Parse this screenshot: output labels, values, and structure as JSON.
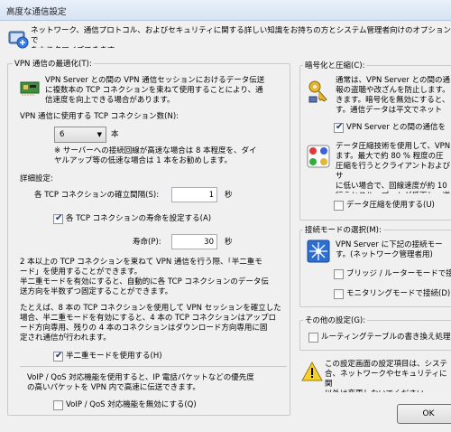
{
  "window": {
    "title": "高度な通信設定"
  },
  "header": {
    "description": "ネットワーク、通信プロトコル、およびセキュリティに関する詳しい知識をお持ちの方とシステム管理者向けのオプションで\nをカスタマイズできます。"
  },
  "vpn": {
    "group_title": "VPN 通信の最適化(T):",
    "intro": "VPN Server との間の VPN 通信セッションにおけるデータ伝送\nに複数本の TCP コネクションを束ねて使用することにより、通\n信速度を向上できる場合があります。",
    "count_label": "VPN 通信に使用する TCP コネクション数(N):",
    "count_value": "6",
    "count_unit": "本",
    "count_note": "※ サーバーへの接続回線が高速な場合は 8 本程度を、ダイ\nヤルアップ等の低速な場合は 1 本をお勧めします。",
    "detail_label": "詳細設定:",
    "interval_label": "各 TCP コネクションの確立間隔(S):",
    "interval_value": "1",
    "interval_unit": "秒",
    "lifetime_check_label": "各 TCP コネクションの寿命を設定する(A)",
    "lifetime_check_checked": true,
    "lifetime_label": "寿命(P):",
    "lifetime_value": "30",
    "lifetime_unit": "秒",
    "half_duplex_text1": "2 本以上の TCP コネクションを束ねて VPN 通信を行う際、「半二重モ\nード」を使用することができます。\n半二重モードを有効にすると、自動的に各 TCP コネクションのデータ伝\n送方向を半数ずつ固定することができます。",
    "half_duplex_text2": "たとえば、8 本の TCP コネクションを使用して VPN セッションを確立した\n場合、半二重モードを有効にすると、4 本の TCP コネクションはアップロ\nード方向専用、残りの 4 本のコネクションはダウンロード方向専用に固\n定され通信が行われます。",
    "half_duplex_check_label": "半二重モードを使用する(H)",
    "half_duplex_check_checked": true,
    "voip_text": "VoIP / QoS 対応機能を使用すると、IP 電話パケットなどの優先度\nの高いパケットを VPN 内で高速に伝送できます。",
    "voip_check_label": "VoIP / QoS 対応機能を無効にする(Q)",
    "voip_check_checked": false
  },
  "encryption": {
    "group_title": "暗号化と圧縮(C):",
    "enc_text": "通常は、VPN Server との間の通\n報の盗聴や改ざんを防止します。\nきます。暗号化を無効にすると、\nす。通信データは平文でネット",
    "enc_check_label": "VPN Server との間の通信を",
    "enc_check_checked": true,
    "comp_text": "データ圧縮技術を使用して、VPN\nます。最大で約 80 % 程度の圧\n圧縮を行うとクライアントおよびサ\nに低い場合で、回線速度が約 10\n行うとスループットが低下し、逆効",
    "comp_check_label": "データ圧縮を使用する(U)",
    "comp_check_checked": false
  },
  "mode": {
    "group_title": "接続モードの選択(M):",
    "text": "VPN Server に下記の接続モー\nす。(ネットワーク管理者用)",
    "bridge_label": "ブリッジ / ルーターモードで接続",
    "bridge_checked": false,
    "monitor_label": "モニタリングモードで接続(D)",
    "monitor_checked": false
  },
  "other": {
    "group_title": "その他の設定(G):",
    "routing_label": "ルーティングテーブルの書き換え処理を",
    "routing_checked": false
  },
  "footer": {
    "note": "この設定画面の設定項目は、システ\n合、ネットワークやセキュリティに関\n以外は変更しないでください。",
    "ok_label": "OK"
  }
}
